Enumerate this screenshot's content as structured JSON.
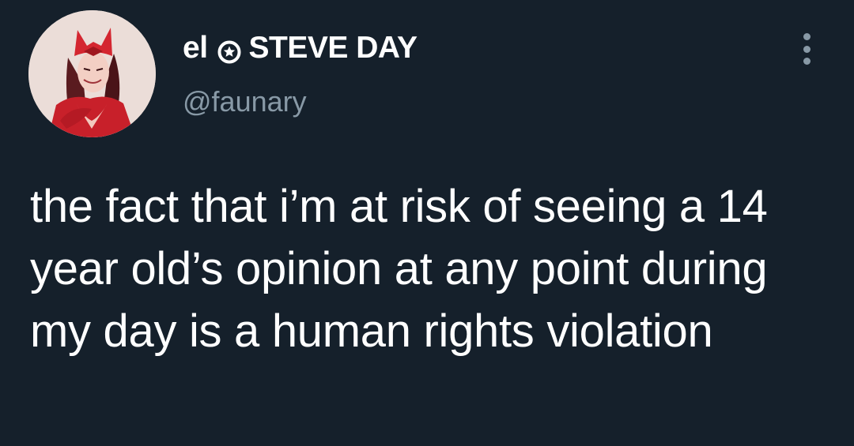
{
  "tweet": {
    "display_name_prefix": "el",
    "display_name_suffix": "STEVE DAY",
    "name_badge_icon": "star-badge-icon",
    "handle": "@faunary",
    "text": "the fact that i’m at risk of seeing a 14 year old’s opinion at any point during my day is a human rights violation",
    "avatar_icon": "scarlet-witch-avatar",
    "menu_icon": "vertical-ellipsis-icon"
  },
  "colors": {
    "background": "#15202b",
    "text_primary": "#ffffff",
    "text_secondary": "#8899a6"
  }
}
